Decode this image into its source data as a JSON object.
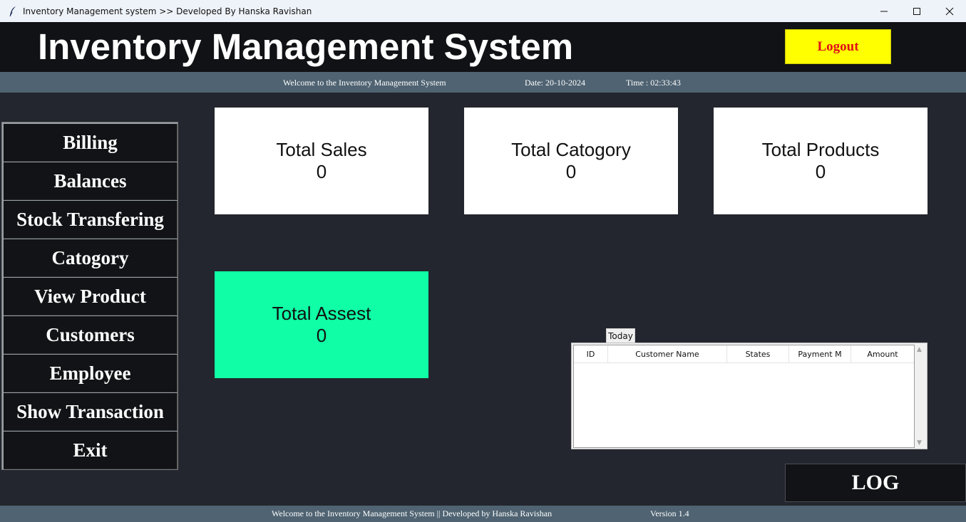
{
  "window": {
    "title": "Inventory Management system  >> Developed By Hanska Ravishan"
  },
  "header": {
    "title": "Inventory Management System",
    "logout_label": "Logout"
  },
  "subheader": {
    "welcome": "Welcome to the Inventory Management System",
    "date": "Date: 20-10-2024",
    "time": "Time : 02:33:43"
  },
  "sidebar": {
    "items": [
      {
        "label": "Billing"
      },
      {
        "label": "Balances"
      },
      {
        "label": "Stock Transfering"
      },
      {
        "label": "Catogory"
      },
      {
        "label": "View Product"
      },
      {
        "label": "Customers"
      },
      {
        "label": "Employee"
      },
      {
        "label": "Show Transaction"
      },
      {
        "label": "Exit"
      }
    ]
  },
  "cards": {
    "sales": {
      "label": "Total Sales",
      "value": "0"
    },
    "category": {
      "label": "Total Catogory",
      "value": "0"
    },
    "products": {
      "label": "Total Products",
      "value": "0"
    },
    "assets": {
      "label": "Total Assest",
      "value": "0"
    }
  },
  "today": {
    "tab_label": "Today",
    "columns": [
      "ID",
      "Customer Name",
      "States",
      "Payment M",
      "Amount"
    ]
  },
  "log": {
    "label": "LOG"
  },
  "footer": {
    "text": "Welcome to the Inventory Management System || Developed by Hanska Ravishan",
    "version": "Version 1.4"
  },
  "colors": {
    "header_bg": "#111215",
    "bar_bg": "#4f6372",
    "body_bg": "#23262e",
    "logout_bg": "#ffff00",
    "logout_text": "#e0101a",
    "assets_card": "#10ffa6"
  }
}
